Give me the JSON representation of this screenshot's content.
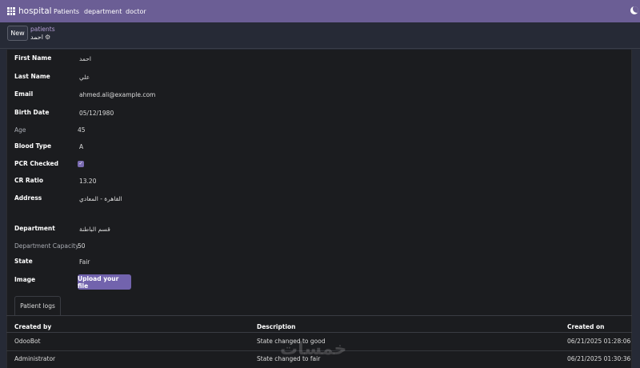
{
  "topbar": {
    "brand": "hospital",
    "nav": [
      "Patients",
      "department",
      "doctor"
    ]
  },
  "control": {
    "new_label": "New",
    "breadcrumb": "patients",
    "record_name": "احمد"
  },
  "form": {
    "first_name_label": "First Name",
    "first_name": "احمد",
    "last_name_label": "Last Name",
    "last_name": "علي",
    "email_label": "Email",
    "email": "ahmed.ali@example.com",
    "birth_date_label": "Birth Date",
    "birth_date": "05/12/1980",
    "age_label": "Age",
    "age": "45",
    "blood_type_label": "Blood Type",
    "blood_type": "A",
    "pcr_label": "PCR Checked",
    "pcr_checked": true,
    "cr_ratio_label": "CR Ratio",
    "cr_ratio": "13.20",
    "address_label": "Address",
    "address": "القاهرة - المعادي",
    "department_label": "Department",
    "department": "قسم الباطنة",
    "dept_capacity_label": "Department Capacity",
    "dept_capacity": "50",
    "state_label": "State",
    "state": "Fair",
    "image_label": "Image",
    "upload_label": "Upload your file"
  },
  "logs": {
    "tab_label": "Patient logs",
    "headers": [
      "Created by",
      "Description",
      "Created on"
    ],
    "rows": [
      [
        "OdooBot",
        "State changed to good",
        "06/21/2025 01:28:06"
      ],
      [
        "Administrator",
        "State changed to fair",
        "06/21/2025 01:30:36"
      ]
    ]
  },
  "watermark": "خمسات",
  "colors": {
    "topbar": "#6b5e95",
    "accent": "#7263ad",
    "sheet": "#1b1c1f"
  }
}
